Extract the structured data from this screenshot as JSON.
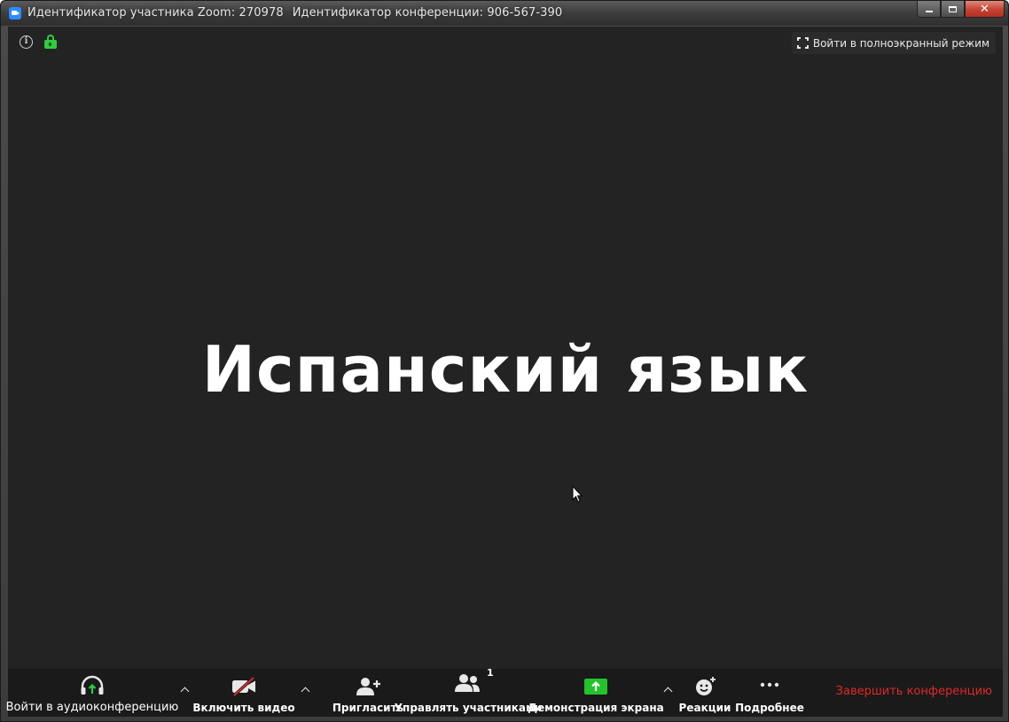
{
  "window": {
    "title_participant": "Идентификатор участника Zoom: 270978",
    "title_conference": "Идентификатор конференции: 906-567-390",
    "controls": {
      "minimize": "minimize",
      "maximize": "maximize",
      "close": "✕"
    }
  },
  "meeting": {
    "fullscreen_label": "Войти в полноэкранный режим",
    "stage_name": "Испанский язык"
  },
  "toolbar": {
    "audio_label": "Войти в аудиоконференцию",
    "video_label": "Включить видео",
    "invite_label": "Пригласить",
    "participants_label": "Управлять участниками",
    "participants_count": "1",
    "share_label": "Демонстрация экрана",
    "reactions_label": "Реакции",
    "more_label": "Подробнее",
    "end_label": "Завершить конференцию"
  },
  "colors": {
    "background": "#232323",
    "toolbar": "#1a1a1a",
    "share_green": "#23c32a",
    "lock_green": "#2ecc40",
    "end_red": "#e02828",
    "audio_accent": "#2ecc40",
    "video_off_red": "#e02828"
  }
}
